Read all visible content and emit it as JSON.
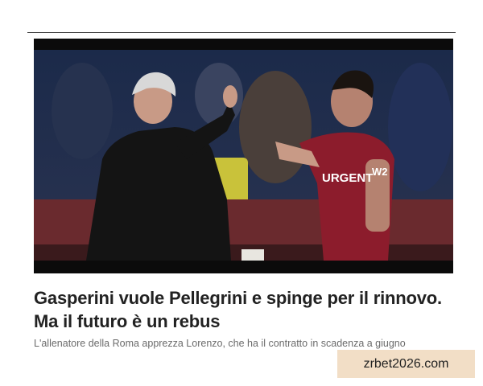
{
  "article": {
    "headline": "Gasperini vuole Pellegrini e spinge per il rinnovo. Ma il futuro è un rebus",
    "subtitle": "L'allenatore della Roma apprezza Lorenzo, che ha il contratto in scadenza a giugno"
  },
  "hero_image": {
    "jersey_sponsor": "URGENT",
    "sleeve_sponsor": "W2"
  },
  "watermark": {
    "text": "zrbet2026.com"
  },
  "colors": {
    "headline": "#222222",
    "subtitle": "#6b6b6b",
    "watermark_bg": "#f2dec6",
    "roma_jersey": "#8c1c2c"
  }
}
